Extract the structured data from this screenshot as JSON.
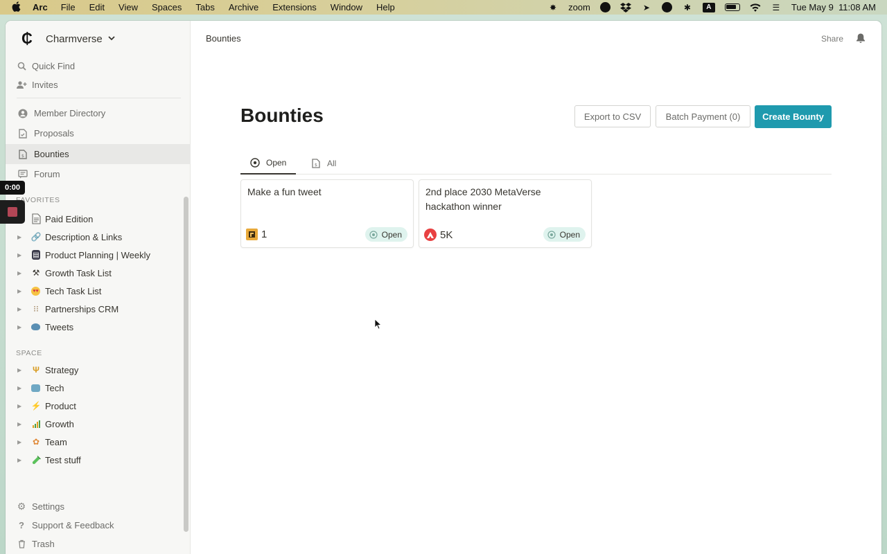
{
  "menubar": {
    "app_name": "Arc",
    "items": [
      "File",
      "Edit",
      "View",
      "Spaces",
      "Tabs",
      "Archive",
      "Extensions",
      "Window",
      "Help"
    ],
    "zoom_label": "zoom",
    "input_label": "A",
    "datetime": "Tue May 9  11:08 AM"
  },
  "sidebar": {
    "workspace_name": "Charmverse",
    "quick": [
      {
        "label": "Quick Find",
        "icon": "search-icon"
      },
      {
        "label": "Invites",
        "icon": "add-user-icon"
      }
    ],
    "nav": [
      {
        "label": "Member Directory",
        "icon": "person-circle-icon"
      },
      {
        "label": "Proposals",
        "icon": "document-icon"
      },
      {
        "label": "Bounties",
        "icon": "bounty-document-icon",
        "active": true
      },
      {
        "label": "Forum",
        "icon": "forum-icon"
      }
    ],
    "favorites_label": "FAVORITES",
    "favorites": [
      {
        "label": "Paid Edition",
        "icon": "page-icon",
        "expandable": false
      },
      {
        "label": "Description & Links",
        "icon": "link-emoji",
        "expandable": true
      },
      {
        "label": "Product Planning | Weekly",
        "icon": "notebook-emoji",
        "expandable": true
      },
      {
        "label": "Growth Task List",
        "icon": "tools-emoji",
        "expandable": true
      },
      {
        "label": "Tech Task List",
        "icon": "heart-eyes-emoji",
        "expandable": true
      },
      {
        "label": "Partnerships CRM",
        "icon": "abacus-emoji",
        "expandable": true
      },
      {
        "label": "Tweets",
        "icon": "bird-emoji",
        "expandable": true
      }
    ],
    "space_label": "SPACE",
    "space": [
      {
        "label": "Strategy",
        "icon": "trident-emoji"
      },
      {
        "label": "Tech",
        "icon": "robot-emoji"
      },
      {
        "label": "Product",
        "icon": "lightning-emoji"
      },
      {
        "label": "Growth",
        "icon": "chart-emoji"
      },
      {
        "label": "Team",
        "icon": "team-emoji"
      },
      {
        "label": "Test stuff",
        "icon": "test-tube-emoji"
      }
    ],
    "footer": [
      {
        "label": "Settings",
        "icon": "gear-icon"
      },
      {
        "label": "Support & Feedback",
        "icon": "question-icon"
      },
      {
        "label": "Trash",
        "icon": "trash-icon"
      }
    ]
  },
  "recording": {
    "time": "0:00"
  },
  "topbar": {
    "title": "Bounties",
    "share_label": "Share"
  },
  "page": {
    "title": "Bounties",
    "export_label": "Export to CSV",
    "batch_label": "Batch Payment (0)",
    "create_label": "Create Bounty",
    "tabs": [
      {
        "label": "Open",
        "active": true
      },
      {
        "label": "All",
        "active": false
      }
    ],
    "bounties": [
      {
        "title": "Make a fun tweet",
        "reward": "1",
        "token_icon": "custom-token-icon",
        "status": "Open"
      },
      {
        "title": "2nd place 2030 MetaVerse hackathon winner",
        "reward": "5K",
        "token_icon": "avax-token-icon",
        "status": "Open"
      }
    ]
  },
  "colors": {
    "primary_button": "#1f9aae",
    "status_bg": "#dff3ee",
    "sidebar_bg": "#f7f7f5",
    "avax_red": "#e84142"
  }
}
